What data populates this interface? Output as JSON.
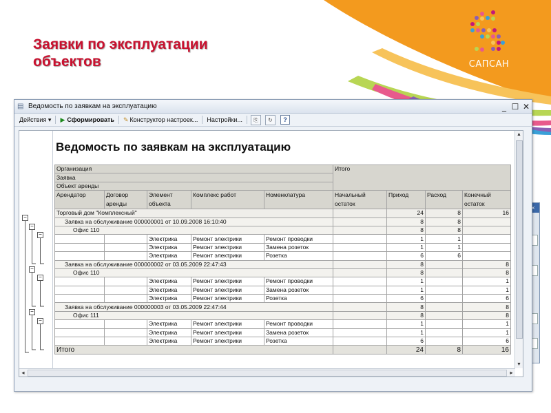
{
  "slide": {
    "title_line1": "Заявки по эксплуатации",
    "title_line2": "объектов",
    "logo_text": "САПСАН"
  },
  "window": {
    "title": "Ведомость по заявкам на эксплуатацию",
    "controls": {
      "minimize": "_",
      "maximize": "☐",
      "close": "✕"
    }
  },
  "toolbar": {
    "actions": "Действия ▾",
    "generate": "Сформировать",
    "constructor": "Конструктор настроек...",
    "settings": "Настройки...",
    "help": "?"
  },
  "report": {
    "title": "Ведомость по заявкам на эксплуатацию",
    "header": {
      "org": "Организация",
      "request": "Заявка",
      "rental": "Объект аренды",
      "total": "Итого",
      "cols": [
        "Арендатор",
        "Договор аренды",
        "Элемент объекта",
        "Комплекс работ",
        "Номенклатура",
        "Начальный остаток",
        "Приход",
        "Расход",
        "Конечный остаток"
      ]
    },
    "rows": [
      {
        "level": 0,
        "label": "Торговый дом \"Комплексный\"",
        "start": "",
        "in": "24",
        "out": "8",
        "end": "16"
      },
      {
        "level": 1,
        "label": "Заявка на обслуживание 000000001 от 10.09.2008 16:10:40",
        "start": "",
        "in": "8",
        "out": "8",
        "end": ""
      },
      {
        "level": 2,
        "label": "Офис 110",
        "start": "",
        "in": "8",
        "out": "8",
        "end": ""
      },
      {
        "level": 3,
        "c1": "",
        "c2": "",
        "c3": "Электрика",
        "c4": "Ремонт электрики",
        "c5": "Ремонт проводки",
        "start": "",
        "in": "1",
        "out": "1",
        "end": ""
      },
      {
        "level": 3,
        "c1": "",
        "c2": "",
        "c3": "Электрика",
        "c4": "Ремонт электрики",
        "c5": "Замена розеток",
        "start": "",
        "in": "1",
        "out": "1",
        "end": ""
      },
      {
        "level": 3,
        "c1": "",
        "c2": "",
        "c3": "Электрика",
        "c4": "Ремонт электрики",
        "c5": "Розетка",
        "start": "",
        "in": "6",
        "out": "6",
        "end": ""
      },
      {
        "level": 1,
        "label": "Заявка на обслуживание 000000002 от 03.05.2009 22:47:43",
        "start": "",
        "in": "8",
        "out": "",
        "end": "8"
      },
      {
        "level": 2,
        "label": "Офис 110",
        "start": "",
        "in": "8",
        "out": "",
        "end": "8"
      },
      {
        "level": 3,
        "c1": "",
        "c2": "",
        "c3": "Электрика",
        "c4": "Ремонт электрики",
        "c5": "Ремонт проводки",
        "start": "",
        "in": "1",
        "out": "",
        "end": "1"
      },
      {
        "level": 3,
        "c1": "",
        "c2": "",
        "c3": "Электрика",
        "c4": "Ремонт электрики",
        "c5": "Замена розеток",
        "start": "",
        "in": "1",
        "out": "",
        "end": "1"
      },
      {
        "level": 3,
        "c1": "",
        "c2": "",
        "c3": "Электрика",
        "c4": "Ремонт электрики",
        "c5": "Розетка",
        "start": "",
        "in": "6",
        "out": "",
        "end": "6"
      },
      {
        "level": 1,
        "label": "Заявка на обслуживание 000000003 от 03.05.2009 22:47:44",
        "start": "",
        "in": "8",
        "out": "",
        "end": "8"
      },
      {
        "level": 2,
        "label": "Офис 111",
        "start": "",
        "in": "8",
        "out": "",
        "end": "8"
      },
      {
        "level": 3,
        "c1": "",
        "c2": "",
        "c3": "Электрика",
        "c4": "Ремонт электрики",
        "c5": "Ремонт проводки",
        "start": "",
        "in": "1",
        "out": "",
        "end": "1"
      },
      {
        "level": 3,
        "c1": "",
        "c2": "",
        "c3": "Электрика",
        "c4": "Ремонт электрики",
        "c5": "Замена розеток",
        "start": "",
        "in": "1",
        "out": "",
        "end": "1"
      },
      {
        "level": 3,
        "c1": "",
        "c2": "",
        "c3": "Электрика",
        "c4": "Ремонт электрики",
        "c5": "Розетка",
        "start": "",
        "in": "6",
        "out": "",
        "end": "6"
      }
    ],
    "total": {
      "label": "Итого",
      "start": "",
      "in": "24",
      "out": "8",
      "end": "16"
    }
  },
  "colors": {
    "title_red": "#c8102e",
    "swoosh_orange": "#f39a1e",
    "swoosh_magenta": "#c2187a",
    "header_gray": "#d7d6cf"
  }
}
